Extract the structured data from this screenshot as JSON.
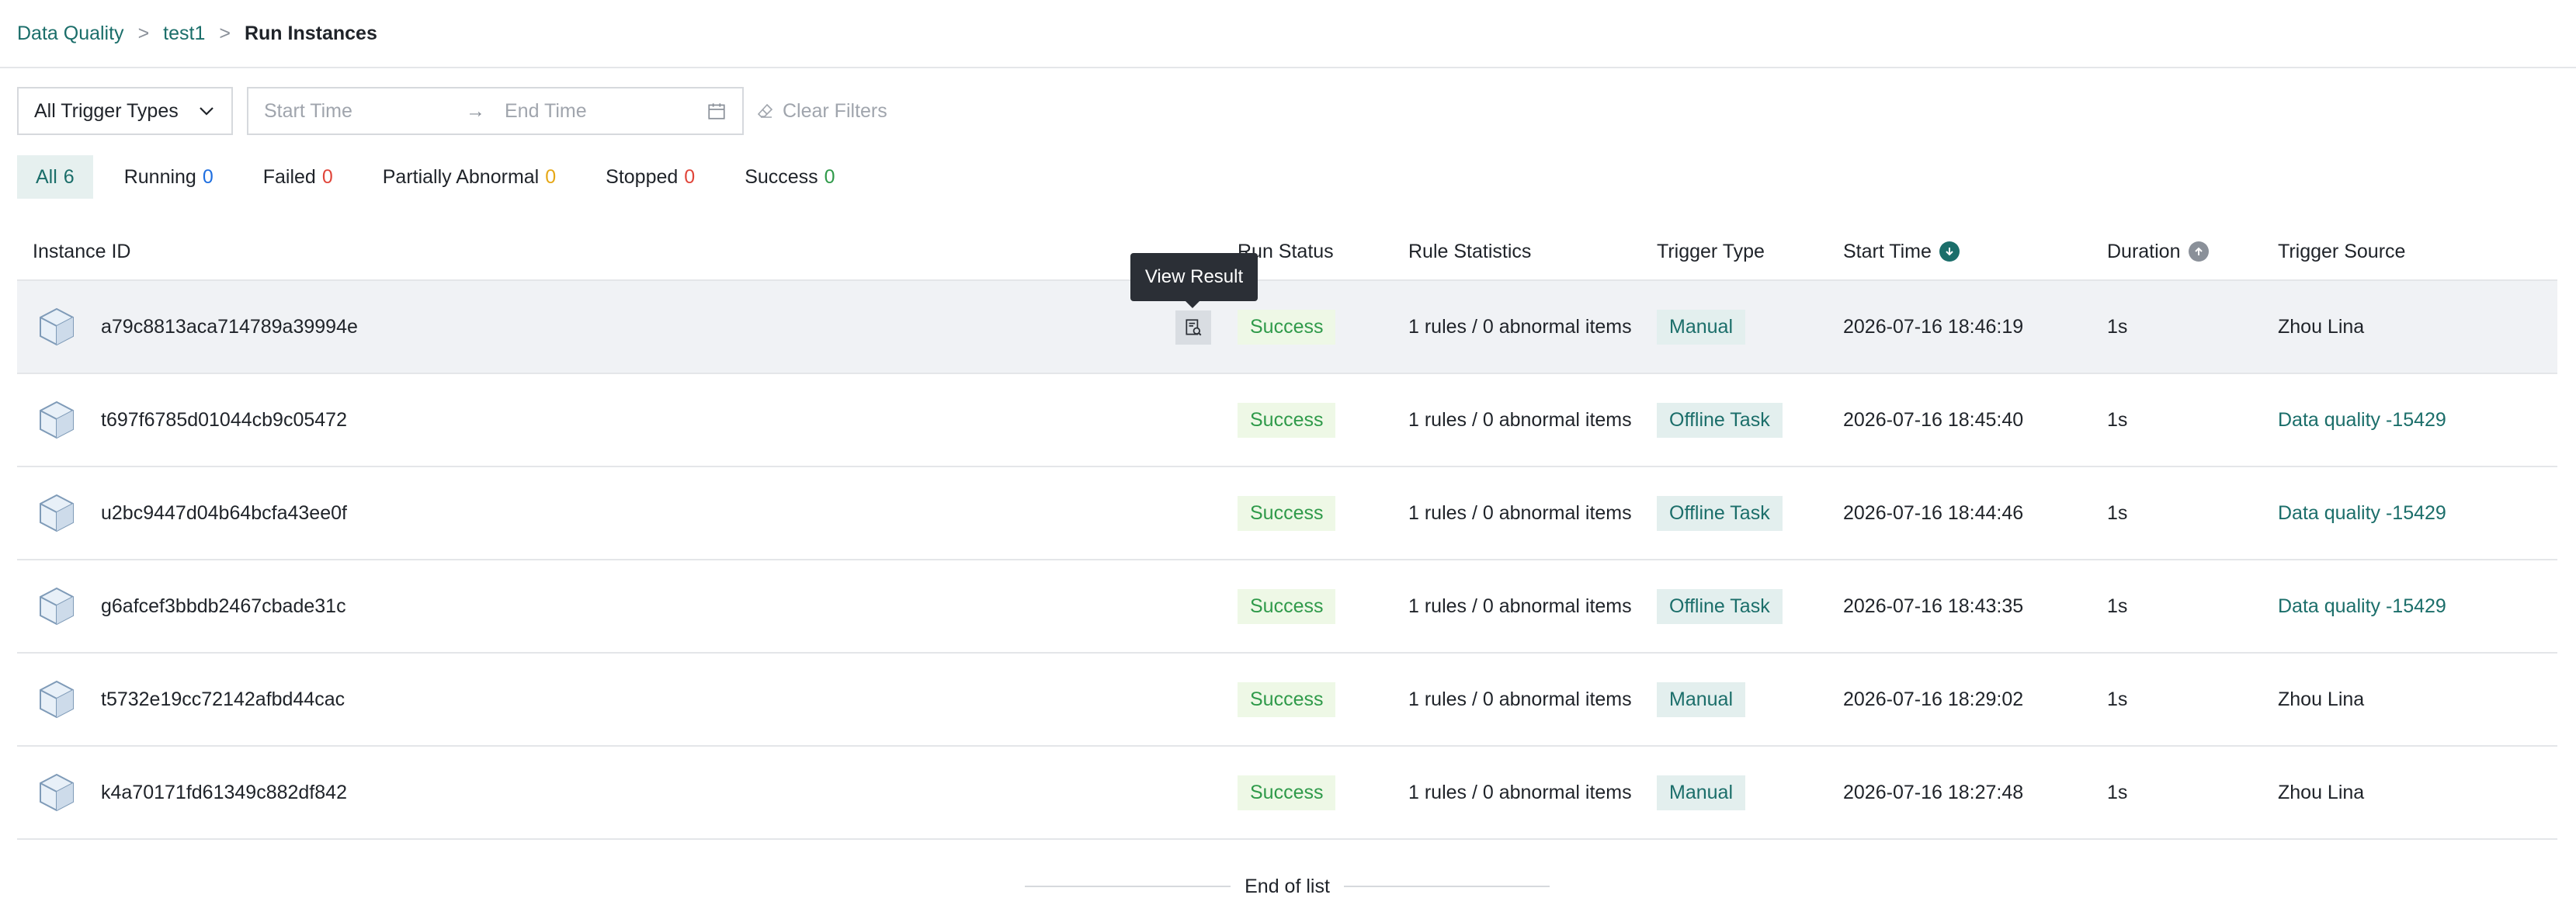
{
  "breadcrumb": {
    "root": "Data Quality",
    "sep1": ">",
    "project": "test1",
    "sep2": ">",
    "current": "Run Instances"
  },
  "filters": {
    "trigger_type": "All Trigger Types",
    "start_placeholder": "Start Time",
    "arrow": "→",
    "end_placeholder": "End Time",
    "clear": "Clear Filters"
  },
  "tabs": [
    {
      "label": "All",
      "count": "6"
    },
    {
      "label": "Running",
      "count": "0"
    },
    {
      "label": "Failed",
      "count": "0"
    },
    {
      "label": "Partially Abnormal",
      "count": "0"
    },
    {
      "label": "Stopped",
      "count": "0"
    },
    {
      "label": "Success",
      "count": "0"
    }
  ],
  "columns": {
    "instance_id": "Instance ID",
    "run_status": "Run Status",
    "rule_stats": "Rule Statistics",
    "trigger_type": "Trigger Type",
    "start_time": "Start Time",
    "duration": "Duration",
    "trigger_source": "Trigger Source"
  },
  "rows": [
    {
      "id": "a79c8813aca714789a39994e",
      "status": "Success",
      "rules": "1 rules / 0 abnormal items",
      "trigger": "Manual",
      "start": "2026-07-16 18:46:19",
      "duration": "1s",
      "source": "Zhou Lina"
    },
    {
      "id": "t697f6785d01044cb9c05472",
      "status": "Success",
      "rules": "1 rules / 0 abnormal items",
      "trigger": "Offline Task",
      "start": "2026-07-16 18:45:40",
      "duration": "1s",
      "source": "Data quality -15429"
    },
    {
      "id": "u2bc9447d04b64bcfa43ee0f",
      "status": "Success",
      "rules": "1 rules / 0 abnormal items",
      "trigger": "Offline Task",
      "start": "2026-07-16 18:44:46",
      "duration": "1s",
      "source": "Data quality -15429"
    },
    {
      "id": "g6afcef3bbdb2467cbade31c",
      "status": "Success",
      "rules": "1 rules / 0 abnormal items",
      "trigger": "Offline Task",
      "start": "2026-07-16 18:43:35",
      "duration": "1s",
      "source": "Data quality -15429"
    },
    {
      "id": "t5732e19cc72142afbd44cac",
      "status": "Success",
      "rules": "1 rules / 0 abnormal items",
      "trigger": "Manual",
      "start": "2026-07-16 18:29:02",
      "duration": "1s",
      "source": "Zhou Lina"
    },
    {
      "id": "k4a70171fd61349c882df842",
      "status": "Success",
      "rules": "1 rules / 0 abnormal items",
      "trigger": "Manual",
      "start": "2026-07-16 18:27:48",
      "duration": "1s",
      "source": "Zhou Lina"
    }
  ],
  "tooltip": "View Result",
  "end_of_list": "End of list",
  "colors": {
    "accent": "#1b6e6a",
    "success": "#2f9a4a",
    "blue": "#1f6fe0",
    "red": "#e0453a",
    "yellow": "#e6a817"
  }
}
